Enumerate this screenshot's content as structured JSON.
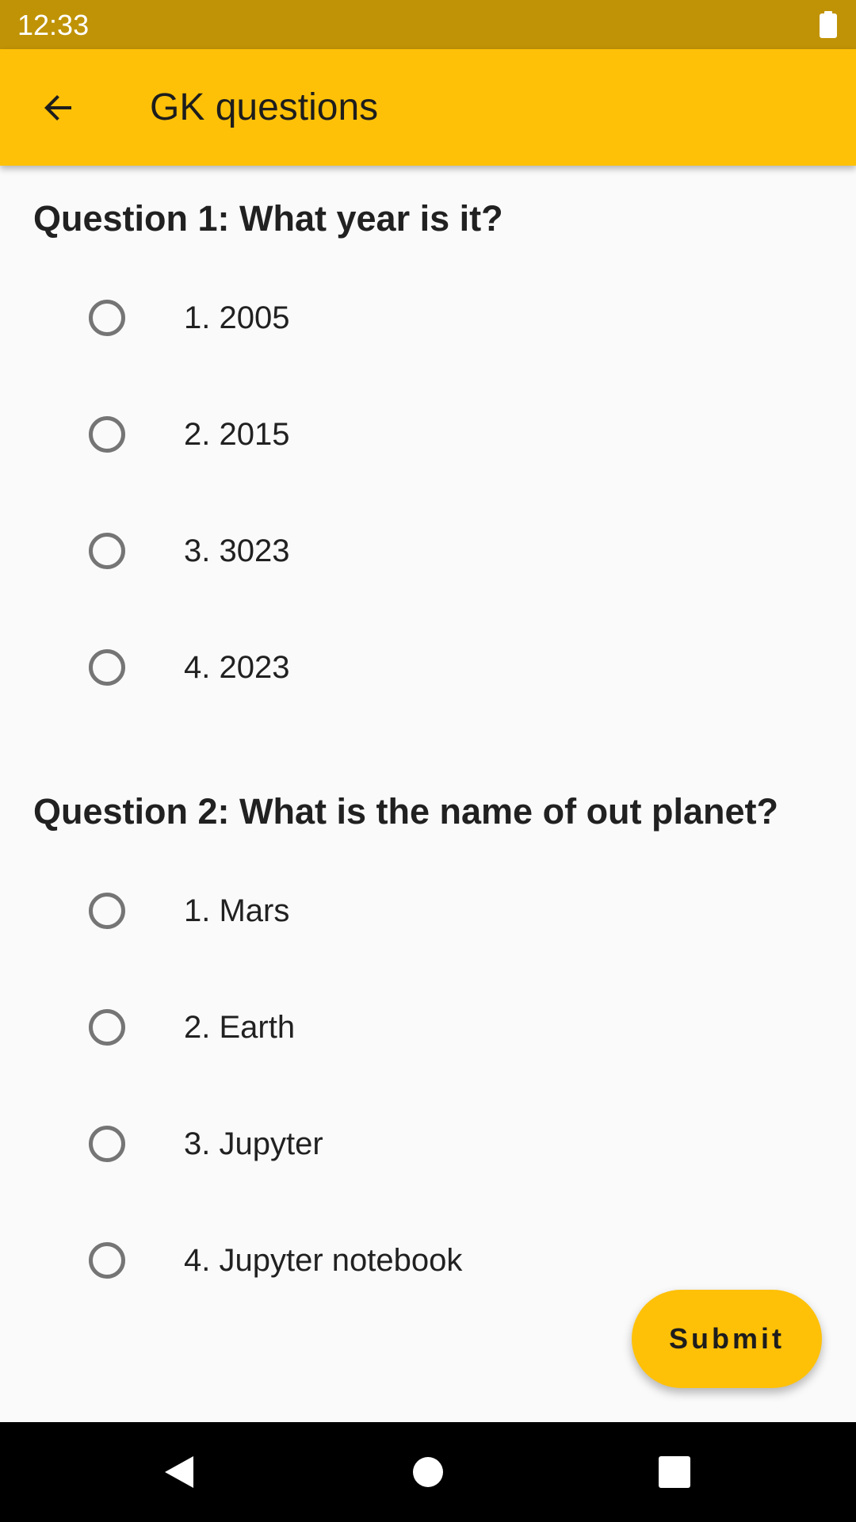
{
  "status_bar": {
    "time": "12:33",
    "battery_icon": "battery-full-icon"
  },
  "app_bar": {
    "back_icon": "arrow-back-icon",
    "title": "GK questions",
    "color": "#ffc107"
  },
  "questions": [
    {
      "title": "Question 1: What year is it?",
      "options": [
        "1. 2005",
        "2. 2015",
        "3. 3023",
        "4. 2023"
      ]
    },
    {
      "title": "Question 2: What is the name of out planet?",
      "options": [
        "1. Mars",
        "2. Earth",
        "3. Jupyter",
        "4. Jupyter notebook"
      ]
    }
  ],
  "submit": {
    "label": "Submit"
  },
  "nav_bar": {
    "back_icon": "nav-back-icon",
    "home_icon": "nav-home-icon",
    "recents_icon": "nav-recents-icon"
  }
}
